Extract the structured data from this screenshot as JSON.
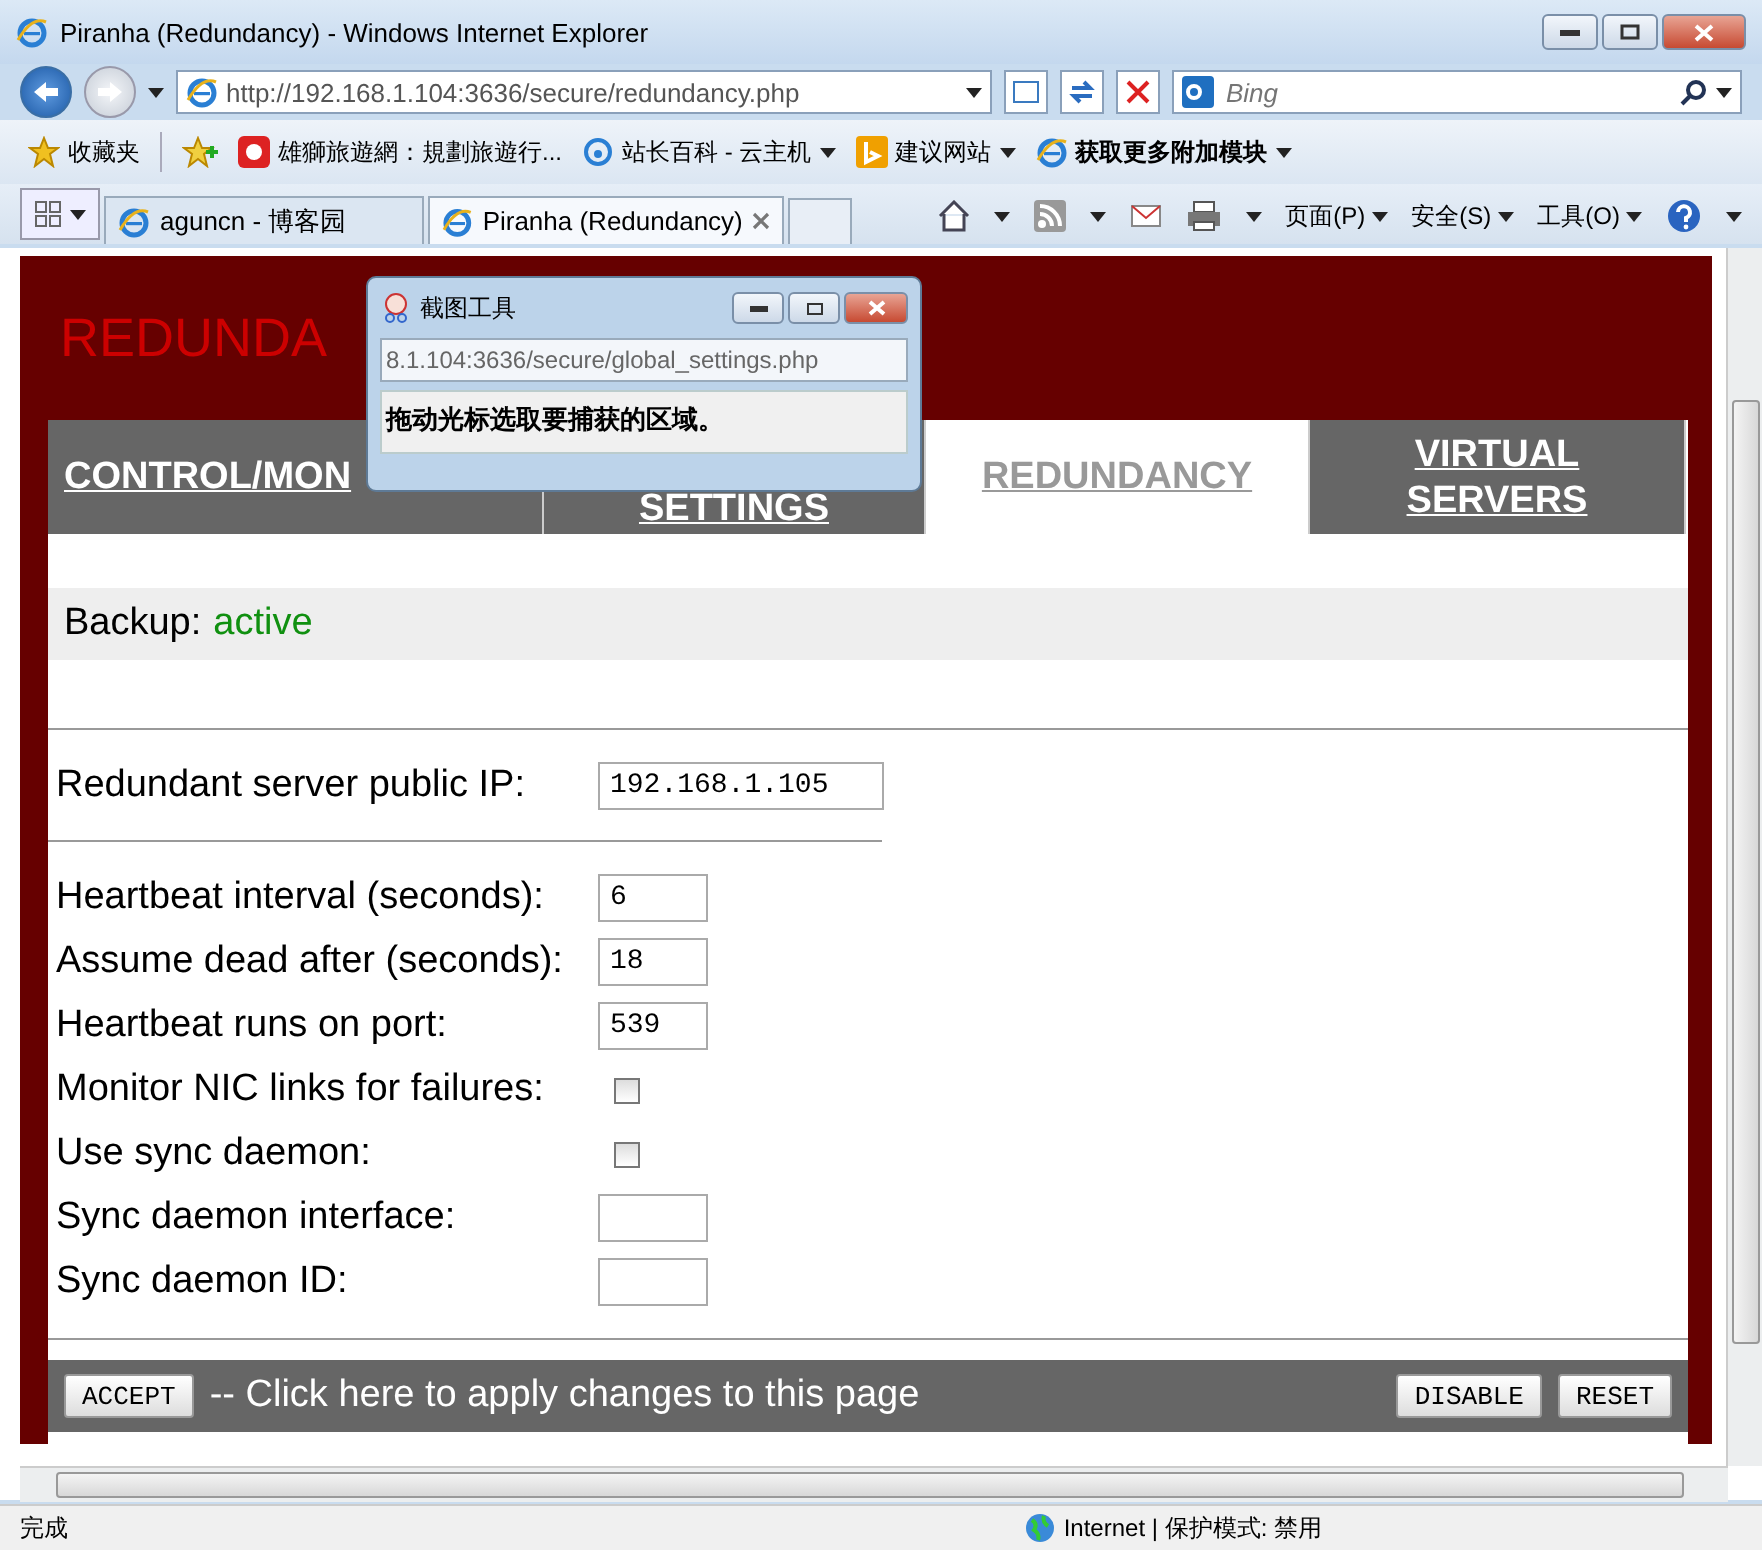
{
  "window": {
    "title": "Piranha (Redundancy) - Windows Internet Explorer"
  },
  "address_bar": {
    "url": "http://192.168.1.104:3636/secure/redundancy.php"
  },
  "search": {
    "placeholder": "Bing"
  },
  "favorites_bar": {
    "label": "收藏夹",
    "items": [
      {
        "label": "雄獅旅遊網：規劃旅遊行...",
        "dropdown": false
      },
      {
        "label": "站长百科 - 云主机",
        "dropdown": true
      },
      {
        "label": "建议网站",
        "dropdown": true
      },
      {
        "label": "获取更多附加模块",
        "dropdown": true
      }
    ]
  },
  "browser_tabs": [
    {
      "label": "aguncn - 博客园",
      "selected": false
    },
    {
      "label": "Piranha (Redundancy)",
      "selected": true
    }
  ],
  "command_bar": {
    "menus": [
      "页面(P)",
      "安全(S)",
      "工具(O)"
    ]
  },
  "page": {
    "heading": "REDUNDA",
    "tabs": [
      {
        "label": "CONTROL/MON",
        "selected": false
      },
      {
        "label": "SETTINGS",
        "selected": false
      },
      {
        "label": "REDUNDANCY",
        "selected": true
      },
      {
        "label": "VIRTUAL SERVERS",
        "selected": false
      }
    ],
    "backup": {
      "label": "Backup:",
      "status": "active",
      "active": true
    },
    "ip_row": {
      "label": "Redundant server public IP:",
      "value": "192.168.1.105"
    },
    "rows": [
      {
        "kind": "text",
        "label": "Heartbeat interval (seconds):",
        "value": "6"
      },
      {
        "kind": "text",
        "label": "Assume dead after (seconds):",
        "value": "18"
      },
      {
        "kind": "text",
        "label": "Heartbeat runs on port:",
        "value": "539"
      },
      {
        "kind": "checkbox",
        "label": "Monitor NIC links for failures:",
        "checked": false
      },
      {
        "kind": "checkbox",
        "label": "Use sync daemon:",
        "checked": false
      },
      {
        "kind": "text",
        "label": "Sync daemon interface:",
        "value": ""
      },
      {
        "kind": "text",
        "label": "Sync daemon ID:",
        "value": ""
      }
    ],
    "footer": {
      "accept": "ACCEPT",
      "hint": "-- Click here to apply changes to this page",
      "buttons": [
        "DISABLE",
        "RESET"
      ]
    }
  },
  "snipping_tool": {
    "title": "截图工具",
    "address": "8.1.104:3636/secure/global_settings.php",
    "message": "拖动光标选取要捕获的区域。"
  },
  "status_bar": {
    "text": "完成",
    "zone": "Internet | 保护模式: 禁用"
  }
}
